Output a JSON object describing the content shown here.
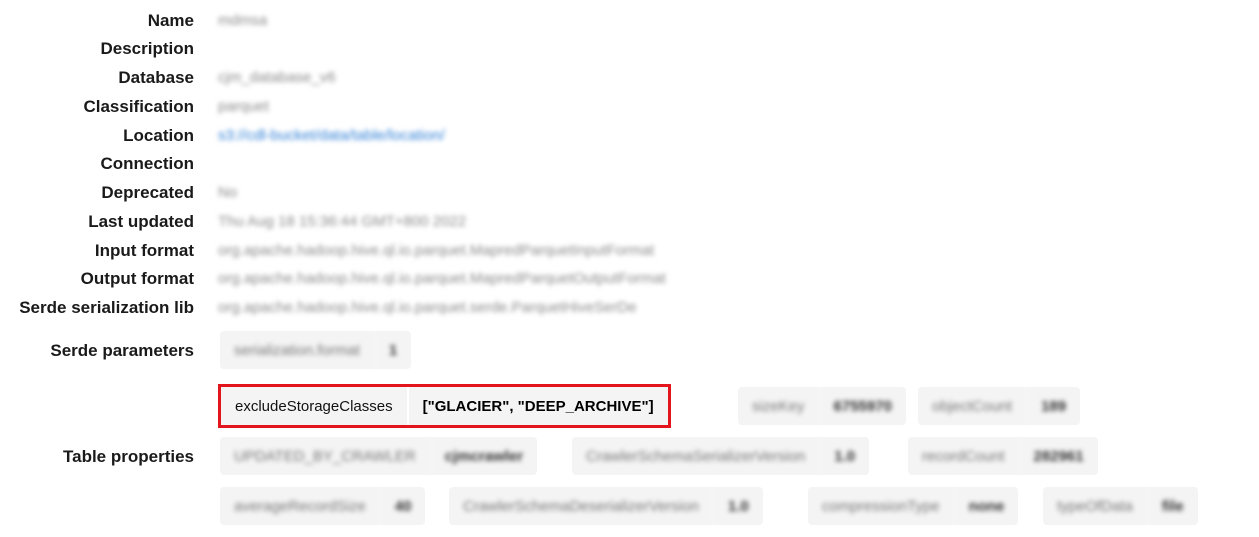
{
  "fields": [
    {
      "label": "Name",
      "value": "mdmsa"
    },
    {
      "label": "Description",
      "value": ""
    },
    {
      "label": "Database",
      "value": "cjm_database_v6"
    },
    {
      "label": "Classification",
      "value": "parquet"
    },
    {
      "label": "Location",
      "value": "s3://cdl-bucket/data/table/location/"
    },
    {
      "label": "Connection",
      "value": ""
    },
    {
      "label": "Deprecated",
      "value": "No"
    },
    {
      "label": "Last updated",
      "value": "Thu Aug 18 15:36:44 GMT+800 2022"
    },
    {
      "label": "Input format",
      "value": "org.apache.hadoop.hive.ql.io.parquet.MapredParquetInputFormat"
    },
    {
      "label": "Output format",
      "value": "org.apache.hadoop.hive.ql.io.parquet.MapredParquetOutputFormat"
    },
    {
      "label": "Serde serialization lib",
      "value": "org.apache.hadoop.hive.ql.io.parquet.serde.ParquetHiveSerDe"
    }
  ],
  "serde_parameters": {
    "label": "Serde parameters",
    "items": [
      {
        "key": "serialization.format",
        "value": "1"
      }
    ]
  },
  "table_properties": {
    "label": "Table properties",
    "highlighted": {
      "key": "excludeStorageClasses",
      "value": "[\"GLACIER\", \"DEEP_ARCHIVE\"]"
    },
    "items": [
      {
        "key": "sizeKey",
        "value": "6755970"
      },
      {
        "key": "objectCount",
        "value": "189"
      },
      {
        "key": "UPDATED_BY_CRAWLER",
        "value": "cjmcrawler"
      },
      {
        "key": "CrawlerSchemaSerializerVersion",
        "value": "1.0"
      },
      {
        "key": "recordCount",
        "value": "282961"
      },
      {
        "key": "averageRecordSize",
        "value": "40"
      },
      {
        "key": "CrawlerSchemaDeserializerVersion",
        "value": "1.0"
      },
      {
        "key": "compressionType",
        "value": "none"
      },
      {
        "key": "typeOfData",
        "value": "file"
      }
    ]
  }
}
